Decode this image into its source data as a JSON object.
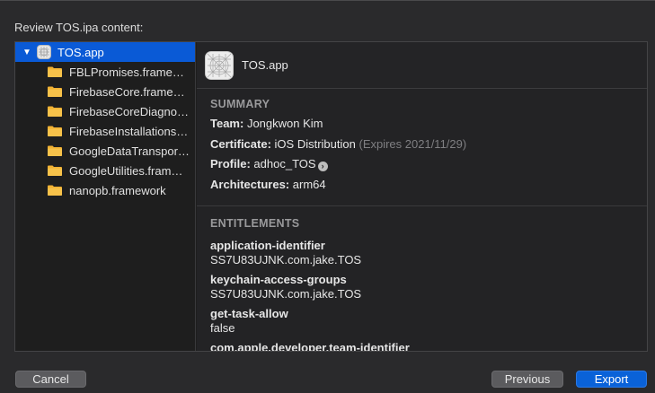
{
  "dialog": {
    "title": "Review TOS.ipa content:"
  },
  "sidebar": {
    "root": {
      "label": "TOS.app",
      "icon": "app-icon",
      "expanded": true
    },
    "items": [
      {
        "label": "FBLPromises.frame…",
        "icon": "folder-icon"
      },
      {
        "label": "FirebaseCore.frame…",
        "icon": "folder-icon"
      },
      {
        "label": "FirebaseCoreDiagno…",
        "icon": "folder-icon"
      },
      {
        "label": "FirebaseInstallations…",
        "icon": "folder-icon"
      },
      {
        "label": "GoogleDataTranspor…",
        "icon": "folder-icon"
      },
      {
        "label": "GoogleUtilities.fram…",
        "icon": "folder-icon"
      },
      {
        "label": "nanopb.framework",
        "icon": "folder-icon"
      }
    ]
  },
  "detail": {
    "header_title": "TOS.app",
    "summary": {
      "title": "SUMMARY",
      "team_label": "Team:",
      "team_value": "Jongkwon Kim",
      "certificate_label": "Certificate:",
      "certificate_value": "iOS Distribution",
      "certificate_expires": "(Expires 2021/11/29)",
      "profile_label": "Profile:",
      "profile_value": "adhoc_TOS",
      "architectures_label": "Architectures:",
      "architectures_value": "arm64"
    },
    "entitlements": {
      "title": "ENTITLEMENTS",
      "items": [
        {
          "key": "application-identifier",
          "value": "SS7U83UJNK.com.jake.TOS"
        },
        {
          "key": "keychain-access-groups",
          "value": "SS7U83UJNK.com.jake.TOS"
        },
        {
          "key": "get-task-allow",
          "value": "false"
        },
        {
          "key": "com.apple.developer.team-identifier",
          "value": ""
        }
      ]
    }
  },
  "buttons": {
    "cancel": "Cancel",
    "previous": "Previous",
    "export": "Export"
  },
  "colors": {
    "selection": "#0a5ad6",
    "accent_button": "#0a62d8",
    "folder": "#f2b233"
  }
}
